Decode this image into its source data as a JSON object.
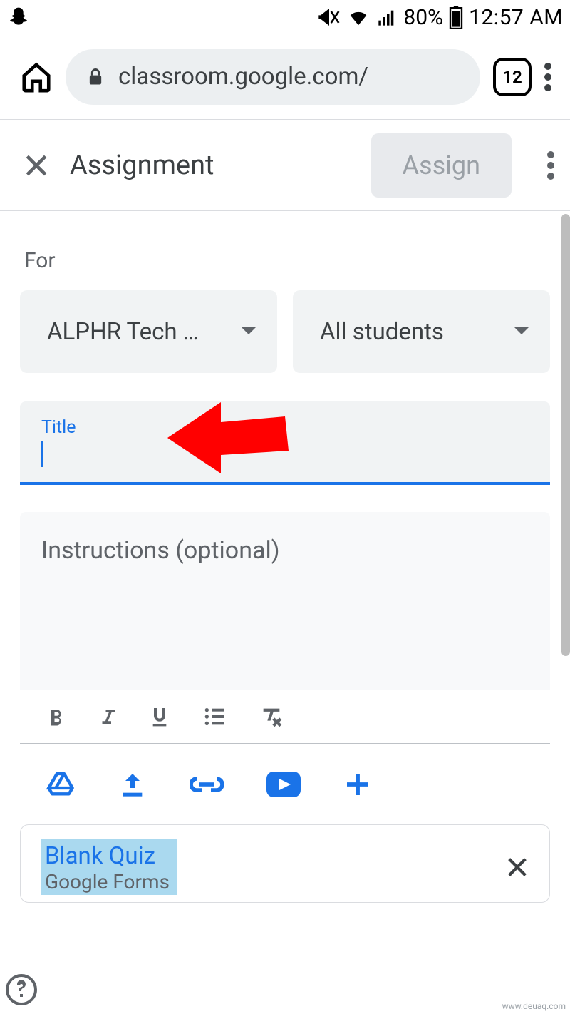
{
  "status": {
    "battery_pct": "80%",
    "time": "12:57 AM"
  },
  "browser": {
    "url": "classroom.google.com/",
    "tab_count": "12"
  },
  "header": {
    "title": "Assignment",
    "assign_label": "Assign"
  },
  "form": {
    "for_label": "For",
    "class_name": "ALPHR Tech …",
    "audience": "All students",
    "title_label": "Title",
    "title_value": "",
    "instructions_placeholder": "Instructions (optional)"
  },
  "attachment": {
    "title": "Blank Quiz",
    "subtitle": "Google Forms"
  },
  "watermark": "www.deuaq.com"
}
